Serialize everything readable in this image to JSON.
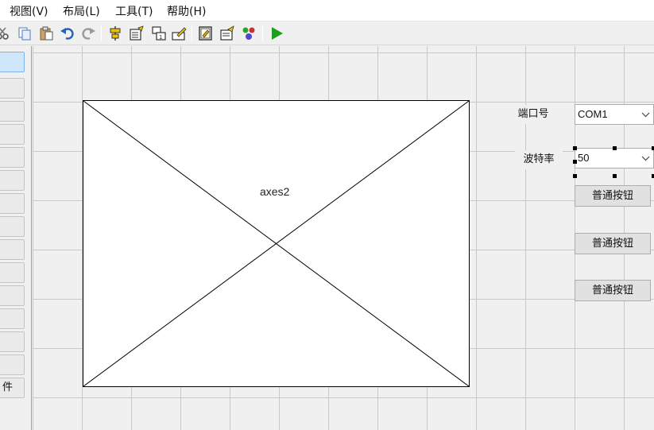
{
  "menubar": {
    "items": [
      {
        "label": "视图(V)"
      },
      {
        "label": "布局(L)"
      },
      {
        "label": "工具(T)"
      },
      {
        "label": "帮助(H)"
      }
    ]
  },
  "toolbar": {
    "icons": [
      "cut-icon",
      "copy-icon",
      "paste-icon",
      "undo-icon",
      "redo-icon",
      "align-icon",
      "menu-editor-icon",
      "tab-order-icon",
      "toolbar-editor-icon",
      "editor-icon",
      "property-inspector-icon",
      "object-browser-icon",
      "run-icon"
    ],
    "colors": {
      "run": "#1e9e1e",
      "undo": "#2b5fb8"
    }
  },
  "palette": {
    "partial_label": "件"
  },
  "canvas": {
    "axes": {
      "label": "axes2"
    },
    "port_label": "端口号",
    "port_value": "COM1",
    "baud_label": "波特率",
    "baud_value": "50",
    "buttons": [
      {
        "label": "普通按钮"
      },
      {
        "label": "普通按钮"
      },
      {
        "label": "普通按钮"
      }
    ]
  }
}
